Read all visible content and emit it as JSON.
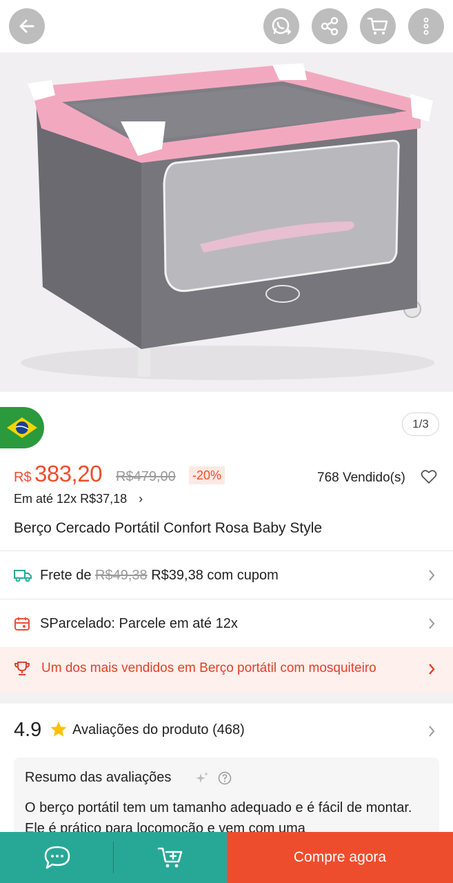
{
  "topbar": {
    "back_icon": "arrow-left-icon",
    "whatsapp_icon": "whatsapp-share-icon",
    "share_icon": "share-icon",
    "cart_icon": "cart-icon",
    "more_icon": "more-vertical-icon"
  },
  "gallery": {
    "image": "pink-grey-portable-crib-photo",
    "counter": "1/3",
    "flag": "brazil-flag-icon"
  },
  "price": {
    "currency": "R$",
    "current": "383,20",
    "original": "R$479,00",
    "discount": "-20%",
    "sold": "768 Vendido(s)",
    "installment_prefix": "Em até",
    "installment": "12x R$37,18"
  },
  "product": {
    "title": "Berço Cercado Portátil Confort Rosa Baby Style"
  },
  "shipping": {
    "label": "Frete de",
    "old": "R$49,38",
    "new": "R$39,38 com cupom"
  },
  "sparcelado": {
    "label": "SParcelado: Parcele em até 12x"
  },
  "best_seller": {
    "label": "Um dos mais vendidos em Berço portátil com mosquiteiro"
  },
  "rating": {
    "score": "4.9",
    "label": "Avaliações do produto",
    "count": "(468)"
  },
  "summary": {
    "title": "Resumo das avaliações",
    "text": "O berço portátil tem um tamanho adequado e é fácil de montar. Ele é prático para locomoção e vem com uma"
  },
  "bottom_bar": {
    "buy_label": "Compre agora"
  },
  "colors": {
    "accent": "#ee4d2d",
    "teal": "#27a896",
    "flag_green": "#2a9a3d"
  }
}
